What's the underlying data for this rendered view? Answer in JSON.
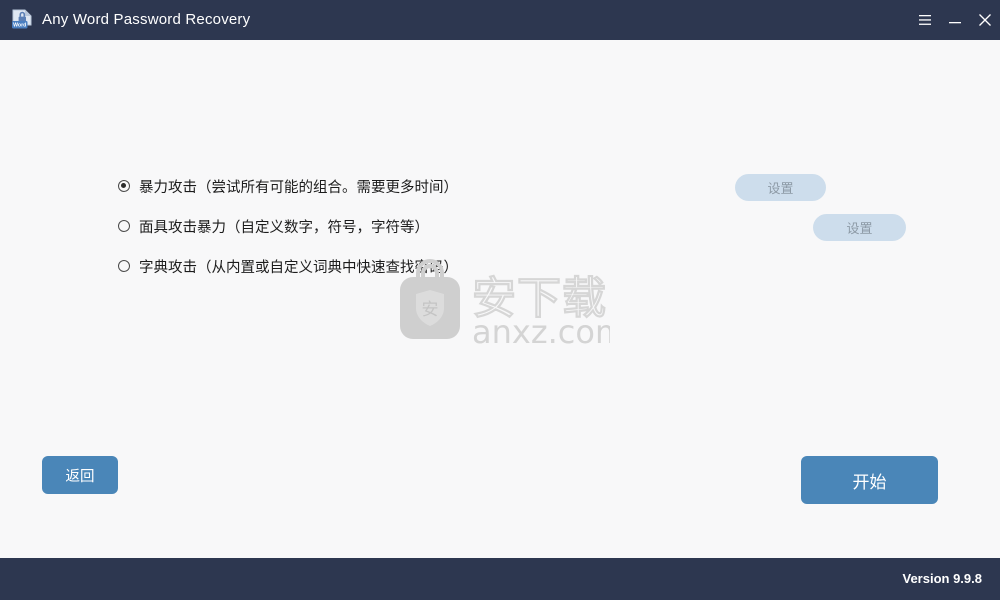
{
  "window": {
    "title": "Any Word Password Recovery",
    "icon": "word-document-lock-icon",
    "titlebar_color": "#2d3750",
    "background_color": "#f8f8f9",
    "controls": [
      {
        "name": "menu-button",
        "icon": "hamburger-menu-icon"
      },
      {
        "name": "minimize-button",
        "icon": "minimize-icon"
      },
      {
        "name": "close-button",
        "icon": "close-icon"
      }
    ]
  },
  "main": {
    "attack_options": [
      {
        "label": "暴力攻击（尝试所有可能的组合。需要更多时间）",
        "selected": true,
        "has_settings": false
      },
      {
        "label": "面具攻击暴力（自定义数字，符号，字符等）",
        "selected": false,
        "has_settings": true,
        "settings_label": "设置"
      },
      {
        "label": "字典攻击（从内置或自定义词典中快速查找密码）",
        "selected": false,
        "has_settings": true,
        "settings_label": "设置"
      }
    ],
    "settings_button_color": "#cdddec",
    "settings_text_color": "#8d9aa6",
    "watermark": {
      "icon": "anxz-bag-shield-icon",
      "shield_glyph": "安",
      "text_cn": "安下载",
      "text_url": "anxz.com"
    }
  },
  "actions": {
    "back_label": "返回",
    "start_label": "开始",
    "button_color": "#4a86b8"
  },
  "footer": {
    "version": "Version 9.9.8"
  }
}
